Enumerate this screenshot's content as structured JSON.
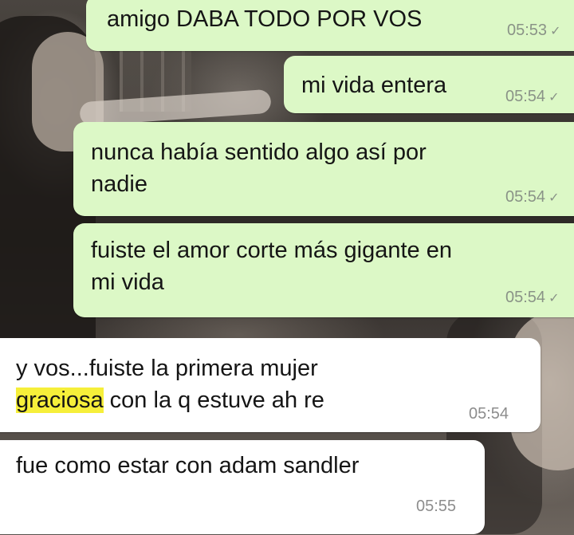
{
  "messages": [
    {
      "direction": "outgoing",
      "lines": [
        "amigo DABA TODO POR VOS"
      ],
      "time": "05:53",
      "status_icon": "check-icon"
    },
    {
      "direction": "outgoing",
      "lines": [
        "mi vida entera"
      ],
      "time": "05:54",
      "status_icon": "check-icon"
    },
    {
      "direction": "outgoing",
      "lines": [
        "nunca había sentido algo así por",
        "nadie"
      ],
      "time": "05:54",
      "status_icon": "check-icon"
    },
    {
      "direction": "outgoing",
      "lines": [
        "fuiste el amor corte más gigante en",
        "mi vida"
      ],
      "time": "05:54",
      "status_icon": "check-icon"
    },
    {
      "direction": "incoming",
      "line1": "y vos...fuiste la primera mujer",
      "highlighted_word": "graciosa",
      "line2_rest": " con la q estuve ah re",
      "time": "05:54"
    },
    {
      "direction": "incoming",
      "lines": [
        "fue como estar con adam sandler"
      ],
      "time": "05:55"
    }
  ],
  "colors": {
    "outgoing_bubble": "#dcf8c6",
    "incoming_bubble": "#ffffff",
    "highlight": "#f6ef3a",
    "timestamp": "#8a9387"
  }
}
